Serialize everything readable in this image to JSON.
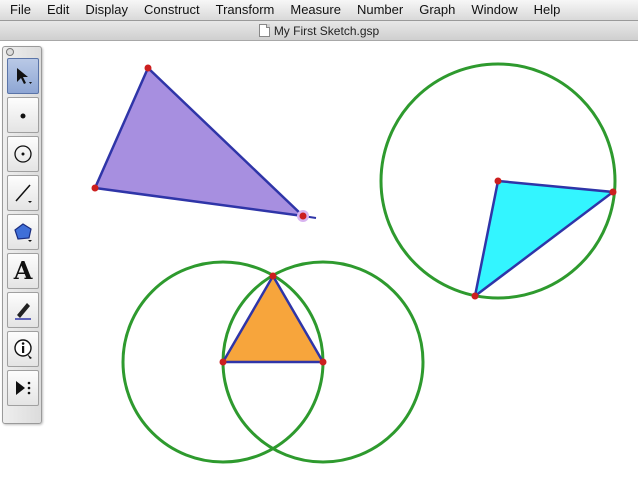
{
  "menubar": {
    "items": [
      "File",
      "Edit",
      "Display",
      "Construct",
      "Transform",
      "Measure",
      "Number",
      "Graph",
      "Window",
      "Help"
    ]
  },
  "window": {
    "title": "My First Sketch.gsp"
  },
  "toolbox": {
    "tools": [
      "arrow-tool",
      "point-tool",
      "compass-tool",
      "straightedge-tool",
      "polygon-tool",
      "text-tool",
      "marker-tool",
      "information-tool",
      "custom-tool"
    ],
    "selected": "arrow-tool",
    "text_tool_glyph": "A"
  },
  "colors": {
    "circle_stroke": "#2e9a2e",
    "polygon_stroke": "#2f35a8",
    "point_fill": "#cc1f1f",
    "triangle_1_fill": "#a78fe0",
    "triangle_2_fill": "#33f5ff",
    "triangle_3_fill": "#f7a53c"
  }
}
